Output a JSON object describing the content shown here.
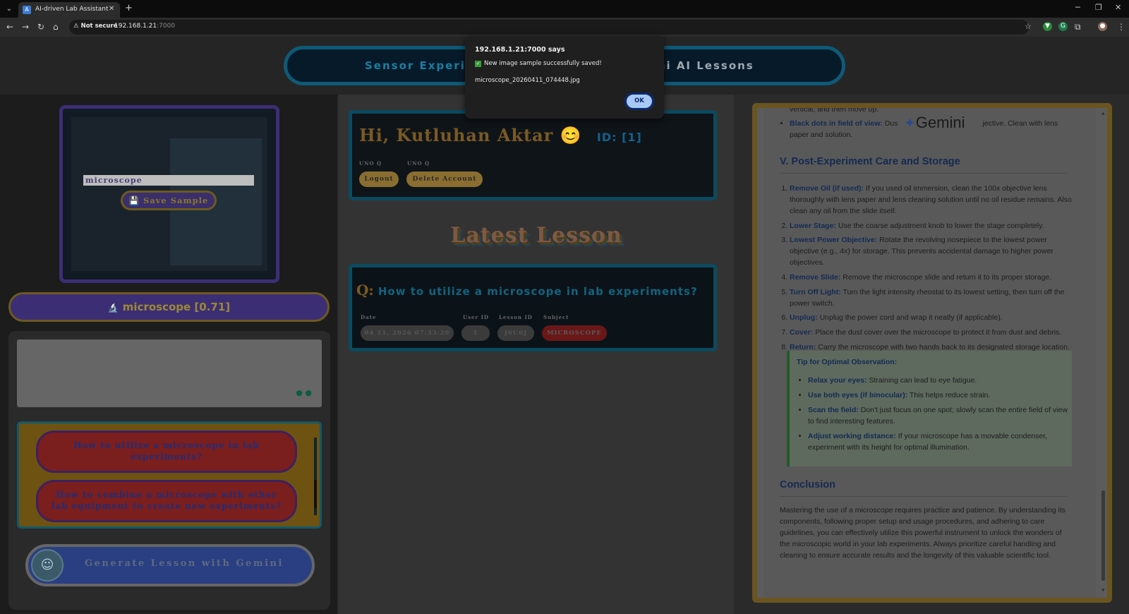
{
  "browser": {
    "tab_title": "AI-driven Lab Assistant",
    "tab_close": "✕",
    "new_tab": "+",
    "security_label": "Not secure",
    "url_host": "192.168.1.21",
    "url_port": ":7000",
    "window_controls": [
      "─",
      "❐",
      "✕"
    ]
  },
  "header": {
    "nav_sensor": "Sensor Experime",
    "nav_gemini": "mini AI Lessons"
  },
  "left": {
    "sample_input_value": "microscope",
    "save_sample_label": "💾 Save Sample",
    "detection_icon": "🔬",
    "detection_text": "microscope [0.71]",
    "questions": [
      "How to utilize a microscope in lab experiments?",
      "How to combine a microscope with other lab equipment to create new experiments?"
    ],
    "generate_label": "Generate Lesson with Gemini"
  },
  "user": {
    "greeting": "Hi, Kutluhan Aktar",
    "emoji": "😊",
    "id_label": "ID: [1]",
    "label_left": "UNO Q",
    "label_right": "UNO Q",
    "logout": "Logout",
    "delete_account": "Delete Account"
  },
  "latest": {
    "title": "Latest Lesson",
    "q_mark": "Q:",
    "question": "How to utilize a microscope in lab experiments?",
    "labels": [
      "Date",
      "User ID",
      "Lesson ID",
      "Subject"
    ],
    "date": "04 11, 2026 07:33:20",
    "user_id": "1",
    "lesson_id": "J6U0J",
    "subject": "MICROSCOPE"
  },
  "doc": {
    "intro_line_1": "vertical, and then move up.",
    "black_dots_label": "Black dots in field of view:",
    "black_dots_text_a": "Dus",
    "black_dots_text_b": "jective. Clean with lens paper and",
    "black_dots_text_c": "solution.",
    "gemini_word": "Gemini",
    "section_v": "V. Post-Experiment Care and Storage",
    "steps": [
      {
        "label": "Remove Oil (if used):",
        "text": "If you used oil immersion, clean the 100x objective lens thoroughly with lens paper and lens cleaning solution until no oil residue remains. Also clean any oil from the slide itself."
      },
      {
        "label": "Lower Stage:",
        "text": "Use the coarse adjustment knob to lower the stage completely."
      },
      {
        "label": "Lowest Power Objective:",
        "text": "Rotate the revolving nosepiece to the lowest power objective (e.g., 4x) for storage. This prevents accidental damage to higher power objectives."
      },
      {
        "label": "Remove Slide:",
        "text": "Remove the microscope slide and return it to its proper storage."
      },
      {
        "label": "Turn Off Light:",
        "text": "Turn the light intensity rheostat to its lowest setting, then turn off the power switch."
      },
      {
        "label": "Unplug:",
        "text": "Unplug the power cord and wrap it neatly (if applicable)."
      },
      {
        "label": "Cover:",
        "text": "Place the dust cover over the microscope to protect it from dust and debris."
      },
      {
        "label": "Return:",
        "text": "Carry the microscope with two hands back to its designated storage location."
      }
    ],
    "tip_title": "Tip for Optimal Observation:",
    "tips": [
      {
        "label": "Relax your eyes:",
        "text": "Straining can lead to eye fatigue."
      },
      {
        "label": "Use both eyes (if binocular):",
        "text": "This helps reduce strain."
      },
      {
        "label": "Scan the field:",
        "text": "Don't just focus on one spot; slowly scan the entire field of view to find interesting features."
      },
      {
        "label": "Adjust working distance:",
        "text": "If your microscope has a movable condenser, experiment with its height for optimal illumination."
      }
    ],
    "conclusion_title": "Conclusion",
    "conclusion_text": "Mastering the use of a microscope requires practice and patience. By understanding its components, following proper setup and usage procedures, and adhering to care guidelines, you can effectively utilize this powerful instrument to unlock the wonders of the microscopic world in your lab experiments. Always prioritize careful handling and cleaning to ensure accurate results and the longevity of this valuable scientific tool."
  },
  "dialog": {
    "title": "192.168.1.21:7000 says",
    "message": "New image sample successfully saved!",
    "filename": "microscope_20260411_074448.jpg",
    "ok_label": "OK"
  },
  "icons": {
    "back": "back-arrow-icon",
    "forward": "forward-arrow-icon",
    "reload": "reload-icon",
    "home": "home-icon",
    "star": "bookmark-star-icon",
    "extensions": "puzzle-icon"
  }
}
